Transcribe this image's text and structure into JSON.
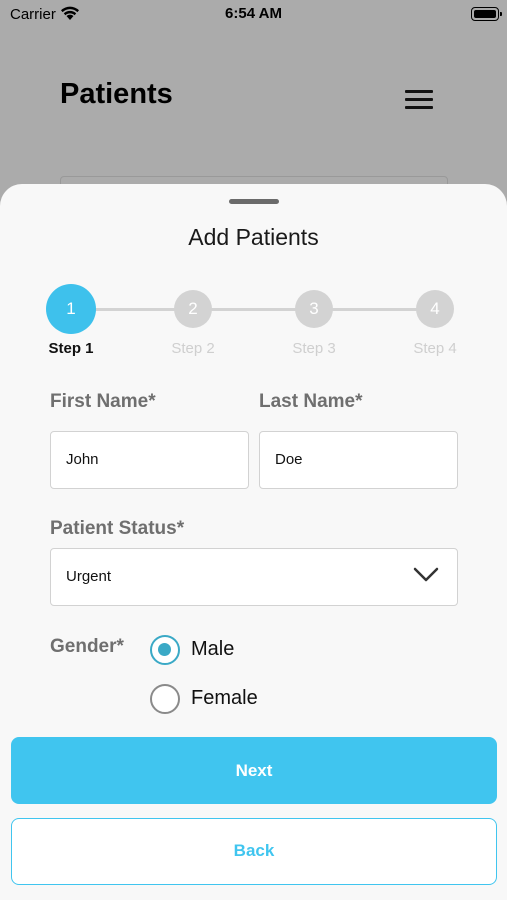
{
  "status_bar": {
    "carrier": "Carrier",
    "time": "6:54 AM"
  },
  "background": {
    "title": "Patients"
  },
  "sheet": {
    "title": "Add Patients",
    "steps": [
      {
        "number": "1",
        "label": "Step 1",
        "active": true
      },
      {
        "number": "2",
        "label": "Step 2",
        "active": false
      },
      {
        "number": "3",
        "label": "Step 3",
        "active": false
      },
      {
        "number": "4",
        "label": "Step 4",
        "active": false
      }
    ],
    "form": {
      "first_name_label": "First Name*",
      "first_name_value": "John",
      "last_name_label": "Last Name*",
      "last_name_value": "Doe",
      "status_label": "Patient Status*",
      "status_value": "Urgent",
      "gender_label": "Gender*",
      "gender_options": [
        {
          "label": "Male",
          "selected": true
        },
        {
          "label": "Female",
          "selected": false
        }
      ]
    },
    "next_label": "Next",
    "back_label": "Back"
  },
  "colors": {
    "accent": "#40c5ef",
    "radio": "#3aa9c6",
    "inactive_step": "#d3d3d3"
  }
}
